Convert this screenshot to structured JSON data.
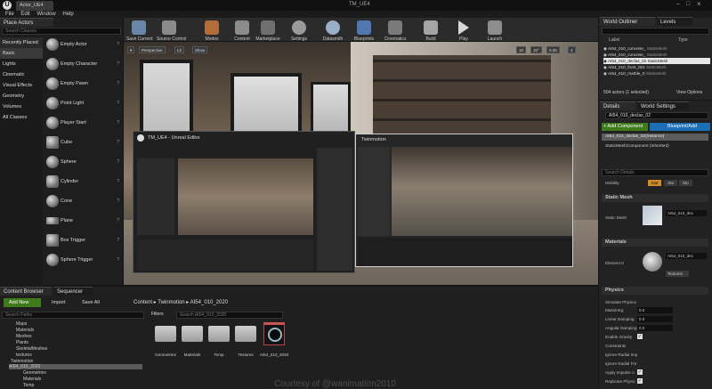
{
  "window": {
    "tab_title": "Actor_UE4",
    "title": "TM_UE4"
  },
  "menu": [
    "File",
    "Edit",
    "Window",
    "Help"
  ],
  "place_actors": {
    "tab": "Place Actors",
    "search_placeholder": "Search Classes",
    "categories": [
      "Recently Placed",
      "Basic",
      "Lights",
      "Cinematic",
      "Visual Effects",
      "Geometry",
      "Volumes",
      "All Classes"
    ],
    "items": [
      "Empty Actor",
      "Empty Character",
      "Empty Pawn",
      "Point Light",
      "Player Start",
      "Cube",
      "Sphere",
      "Cylinder",
      "Cone",
      "Plane",
      "Box Trigger",
      "Sphere Trigger"
    ]
  },
  "toolbar": [
    "Save Current",
    "Source Control",
    "Modes",
    "Content",
    "Marketplace",
    "Settings",
    "Datasmith",
    "Blueprints",
    "Cinematics",
    "Build",
    "Play",
    "Launch"
  ],
  "viewport": {
    "perspective": "Perspective",
    "lit": "Lit",
    "show": "Show",
    "right_controls": [
      "10",
      "10°",
      "0.25",
      "4"
    ],
    "overlay_left_title": "TM_UE4 - Unreal Editor",
    "overlay_right_title": "Twinmotion"
  },
  "outliner": {
    "tab1": "World Outliner",
    "tab2": "Levels",
    "col_label": "Label",
    "col_type": "Type",
    "rows": [
      {
        "label": "AI54_010_concrete_",
        "type": "StaticMesh"
      },
      {
        "label": "AI54_010_concrete_",
        "type": "StaticMesh"
      },
      {
        "label": "AI54_010_declas_02",
        "type": "StaticMesh"
      },
      {
        "label": "AI54_010_front_001",
        "type": "StaticMesh"
      },
      {
        "label": "AI54_010_marble_0",
        "type": "StaticMesh"
      }
    ],
    "count": "504 actors (1 selected)",
    "view_options": "View Options"
  },
  "details": {
    "tab1": "Details",
    "tab2": "World Settings",
    "name": "AI54_010_declas_02",
    "add_component": "+ Add Component",
    "blueprint": "Blueprint/Add",
    "instance": "AI54_010_declas_02(Instance)",
    "component": "StaticMeshComponent (Inherited)",
    "search_placeholder": "Search Details",
    "mobility_label": "Mobility",
    "mobility_options": [
      "Stat",
      "Sta",
      "Mo"
    ],
    "static_mesh_header": "Static Mesh",
    "static_mesh_label": "Static Mesh",
    "static_mesh_value": "AI54_010_dec",
    "materials_header": "Materials",
    "element_label": "Element 0",
    "element_value": "AI54_010_dec",
    "textures": "Textures",
    "physics_header": "Physics",
    "physics": [
      {
        "label": "Simulate Physics",
        "value": ""
      },
      {
        "label": "MassInKg",
        "value": "0.0"
      },
      {
        "label": "Linear Damping",
        "value": "0.0"
      },
      {
        "label": "Angular Damping",
        "value": "0.0"
      },
      {
        "label": "Enable Gravity",
        "value": "check"
      },
      {
        "label": "Constraints",
        "value": ""
      },
      {
        "label": "Ignore Radial Imp",
        "value": ""
      },
      {
        "label": "Ignore Radial For",
        "value": ""
      },
      {
        "label": "Apply Impulse o",
        "value": "check"
      },
      {
        "label": "Replicate Physic",
        "value": "check"
      }
    ]
  },
  "content_browser": {
    "tab1": "Content Browser",
    "tab2": "Sequencer",
    "add_new": "Add New",
    "import": "Import",
    "save_all": "Save All",
    "path": [
      "Content",
      "Twinmotion",
      "AI54_010_2020"
    ],
    "search_paths": "Search Paths",
    "filters": "Filters",
    "search_placeholder": "Search AI54_010_2020",
    "tree": [
      "Maps",
      "Materials",
      "Meshes",
      "Plants",
      "SkeletalMeshes",
      "textures",
      "Twinmotion",
      "AI54_010_2020",
      "Geometries",
      "Materials",
      "Temp",
      "Textures"
    ],
    "assets": [
      "Geometries",
      "Materials",
      "Temp",
      "Textures",
      "AI54_010_2020"
    ]
  },
  "watermark": "Courtesy of @wanimation2010",
  "colors": {
    "accent_green": "#3f7a1d",
    "accent_blue": "#1a6fb5",
    "selection": "#5c5c5c"
  }
}
